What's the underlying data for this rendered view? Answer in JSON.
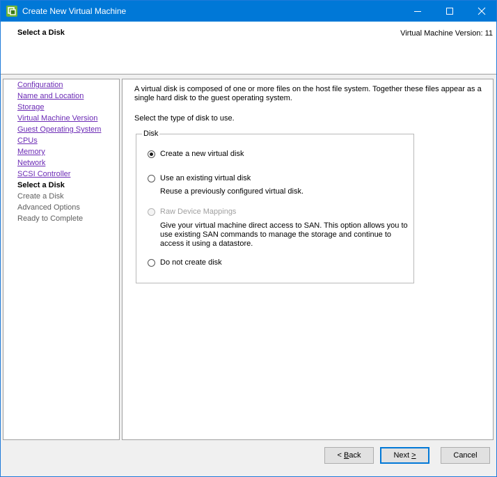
{
  "window": {
    "title": "Create New Virtual Machine",
    "accent_color": "#0078d7"
  },
  "header": {
    "title": "Select a Disk",
    "version_text": "Virtual Machine Version: 11"
  },
  "nav": {
    "items": [
      {
        "label": "Configuration",
        "state": "link"
      },
      {
        "label": "Name and Location",
        "state": "link"
      },
      {
        "label": "Storage",
        "state": "link"
      },
      {
        "label": "Virtual Machine Version",
        "state": "link"
      },
      {
        "label": "Guest Operating System",
        "state": "link"
      },
      {
        "label": "CPUs",
        "state": "link"
      },
      {
        "label": "Memory",
        "state": "link"
      },
      {
        "label": "Network",
        "state": "link"
      },
      {
        "label": "SCSI Controller",
        "state": "link"
      },
      {
        "label": "Select a Disk",
        "state": "current"
      },
      {
        "label": "Create a Disk",
        "state": "pending"
      },
      {
        "label": "Advanced Options",
        "state": "pending"
      },
      {
        "label": "Ready to Complete",
        "state": "pending"
      }
    ]
  },
  "content": {
    "description": "A virtual disk is composed of one or more files on the host file system. Together these files appear as a single hard disk to the guest operating system.",
    "prompt": "Select the type of disk to use.",
    "group_label": "Disk",
    "options": [
      {
        "label": "Create a new virtual disk",
        "checked": true,
        "enabled": true,
        "description": ""
      },
      {
        "label": "Use an existing virtual disk",
        "checked": false,
        "enabled": true,
        "description": "Reuse a previously configured virtual disk."
      },
      {
        "label": "Raw Device Mappings",
        "checked": false,
        "enabled": false,
        "description": "Give your virtual machine direct access to SAN. This option allows you to use existing SAN commands to manage the storage and continue to access it using a datastore."
      },
      {
        "label": "Do not create disk",
        "checked": false,
        "enabled": true,
        "description": ""
      }
    ]
  },
  "buttons": {
    "back": {
      "mnemonic": "B",
      "rest": "ack",
      "prefix": "< "
    },
    "next": {
      "prefix": "Next ",
      "mnemonic": ">"
    },
    "cancel": "Cancel"
  }
}
